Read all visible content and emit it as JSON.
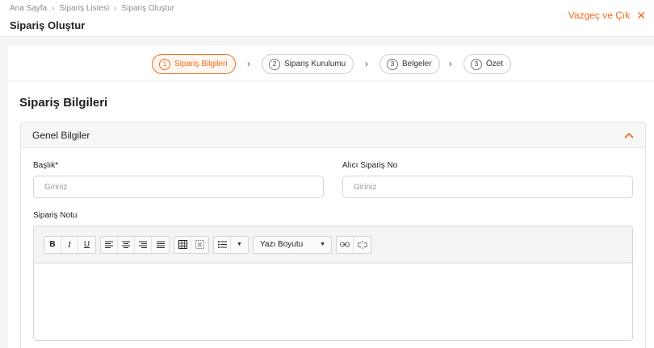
{
  "breadcrumb": {
    "items": [
      "Ana Sayfa",
      "Sipariş Listesi",
      "Sipariş Oluştur"
    ]
  },
  "page": {
    "title": "Sipariş Oluştur"
  },
  "exit": {
    "label": "Vazgeç ve Çık"
  },
  "stepper": {
    "steps": [
      {
        "number": "1",
        "label": "Sipariş Bilgileri",
        "active": true
      },
      {
        "number": "2",
        "label": "Sipariş Kurulumu",
        "active": false
      },
      {
        "number": "3",
        "label": "Belgeler",
        "active": false
      },
      {
        "number": "3",
        "label": "Özet",
        "active": false
      }
    ]
  },
  "section": {
    "title": "Sipariş Bilgileri"
  },
  "panel": {
    "title": "Genel Bilgiler",
    "fields": {
      "baslik": {
        "label": "Başlık*",
        "placeholder": "Giriniz",
        "value": ""
      },
      "alici": {
        "label": "Alıcı Sipariş No",
        "placeholder": "Giriniz",
        "value": ""
      }
    },
    "note": {
      "label": "Sipariş Notu",
      "font_size_label": "Yazı Boyutu"
    }
  },
  "colors": {
    "accent": "#f26b1d",
    "border": "#d6d6d6",
    "background": "#f5f5f5"
  }
}
